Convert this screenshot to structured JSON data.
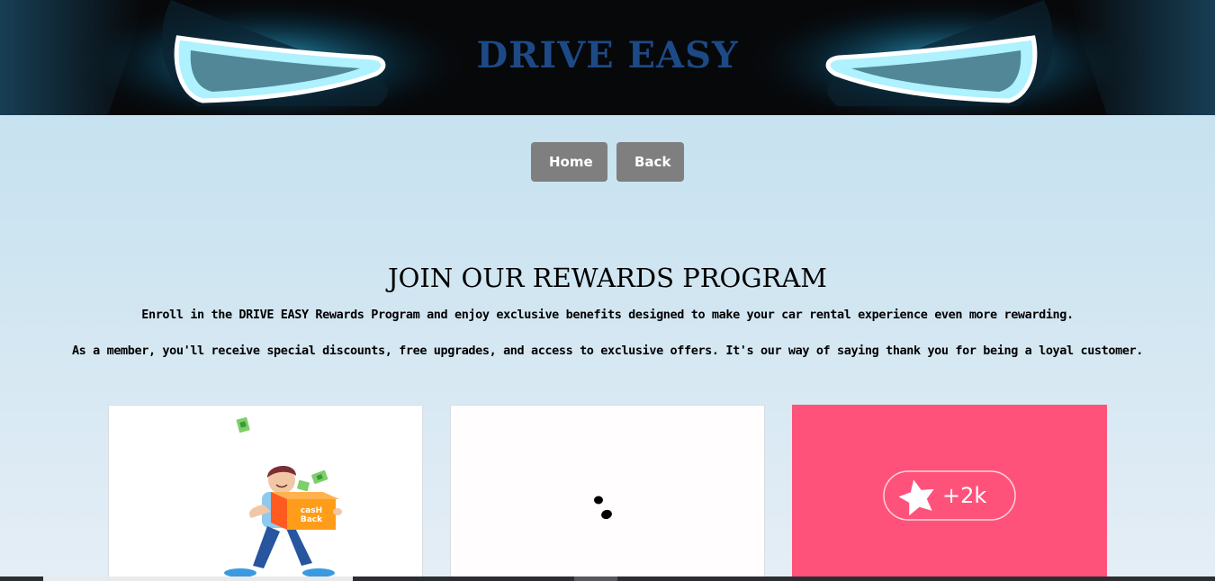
{
  "header": {
    "brand": "DRIVE EASY"
  },
  "nav": {
    "home_label": "Home",
    "back_label": "Back"
  },
  "rewards": {
    "heading": "JOIN OUR REWARDS PROGRAM",
    "paragraph_1": "Enroll in the DRIVE EASY Rewards Program and enjoy exclusive benefits designed to make your car rental experience even more rewarding.",
    "paragraph_2": "As a member, you'll receive special discounts, free upgrades, and access to exclusive offers. It's our way of saying thank you for being a loyal customer."
  },
  "cards": [
    {
      "image": "cashback-illustration",
      "box_text": "casH\nBack"
    },
    {
      "image": "loading-dots"
    },
    {
      "image": "star-badge",
      "badge_text": "+2k"
    }
  ],
  "colors": {
    "banner_bg": "#07080a",
    "brand_title": "#1d4a86",
    "headlight_glow": "#2ec8ff",
    "button_bg": "#7f7f7f",
    "page_bg_top": "#c0dff0",
    "page_bg_bottom": "#e5eef6",
    "badge_card_bg": "#ff527b"
  }
}
